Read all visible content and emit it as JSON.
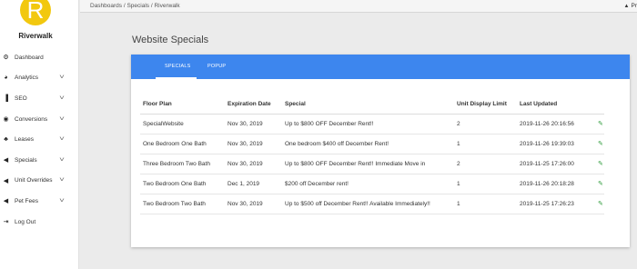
{
  "brand": {
    "logo_letter": "R",
    "name": "Riverwalk",
    "logo_color": "#f2c80f"
  },
  "sidebar": {
    "items": [
      {
        "label": "Dashboard",
        "icon": "dashboard-icon",
        "glyph": "⚙",
        "has_chevron": false
      },
      {
        "label": "Analytics",
        "icon": "pie-chart-icon",
        "glyph": "◕",
        "has_chevron": true
      },
      {
        "label": "SEO",
        "icon": "bar-chart-icon",
        "glyph": "▐",
        "has_chevron": true
      },
      {
        "label": "Conversions",
        "icon": "target-icon",
        "glyph": "◉",
        "has_chevron": true
      },
      {
        "label": "Leases",
        "icon": "users-icon",
        "glyph": "♣",
        "has_chevron": true
      },
      {
        "label": "Specials",
        "icon": "megaphone-icon",
        "glyph": "◀",
        "has_chevron": true
      },
      {
        "label": "Unit Overrides",
        "icon": "megaphone-icon",
        "glyph": "◀",
        "has_chevron": true
      },
      {
        "label": "Pet Fees",
        "icon": "megaphone-icon",
        "glyph": "◀",
        "has_chevron": true
      },
      {
        "label": "Log Out",
        "icon": "logout-icon",
        "glyph": "⇥",
        "has_chevron": false
      }
    ]
  },
  "topbar": {
    "breadcrumb": "Dashboards  /  Specials / Riverwalk",
    "user_label": "Pr"
  },
  "main": {
    "title": "Website Specials",
    "tabs": [
      {
        "label": "SPECIALS",
        "active": true
      },
      {
        "label": "POPUP",
        "active": false
      }
    ],
    "accent": "#3d86ee",
    "table": {
      "headers": [
        "Floor Plan",
        "Expiration Date",
        "Special",
        "Unit Display Limit",
        "Last Updated",
        ""
      ],
      "rows": [
        [
          "SpecialWebsite",
          "Nov 30, 2019",
          "Up to $800 OFF December Rent!!",
          "2",
          "2019-11-26 20:16:56"
        ],
        [
          "One Bedroom One Bath",
          "Nov 30, 2019",
          "One bedroom $400 off December Rent!",
          "1",
          "2019-11-26 19:39:03"
        ],
        [
          "Three Bedroom Two Bath",
          "Nov 30, 2019",
          "Up to $800 OFF December Rent!! Immediate Move in",
          "2",
          "2019-11-25 17:26:00"
        ],
        [
          "Two Bedroom One Bath",
          "Dec 1, 2019",
          "$200 off December rent!",
          "1",
          "2019-11-26 20:18:28"
        ],
        [
          "Two Bedroom Two Bath",
          "Nov 30, 2019",
          "Up to $500 off December Rent!! Available Immediately!!",
          "1",
          "2019-11-25 17:26:23"
        ]
      ],
      "edit_icon": "pencil-icon",
      "edit_color": "#2e9b3a"
    }
  }
}
